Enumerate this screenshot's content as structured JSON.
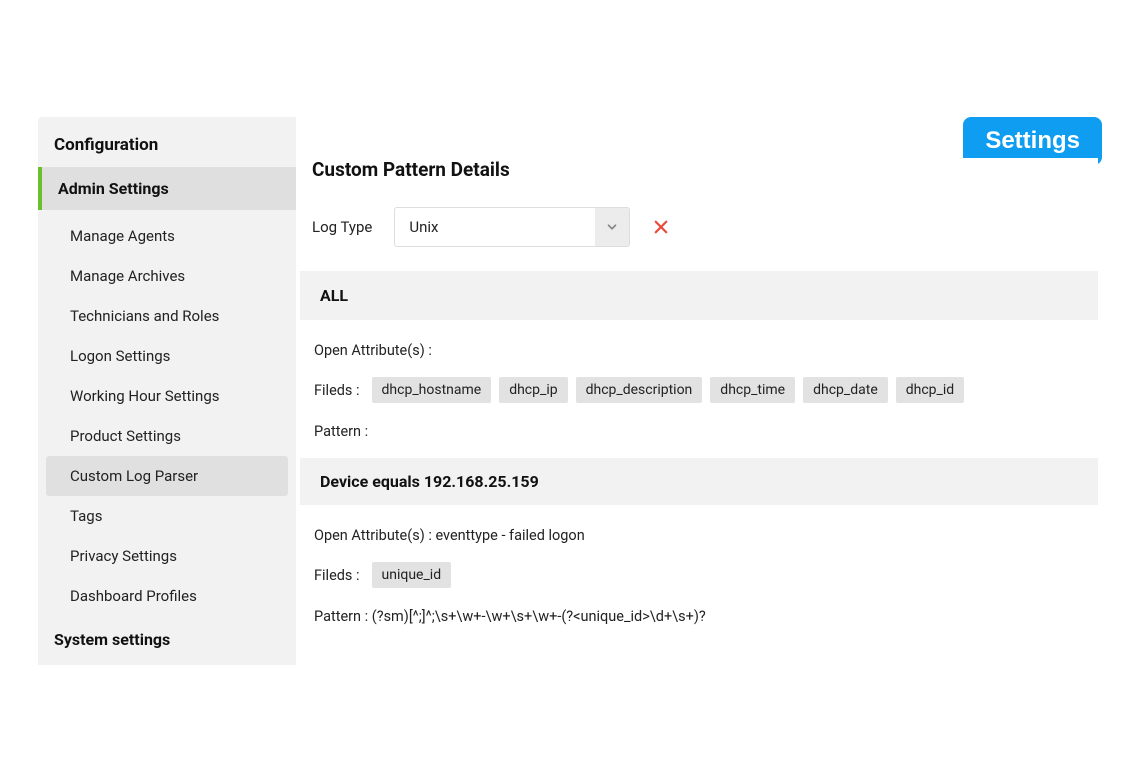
{
  "settingsButton": "Settings",
  "sidebar": {
    "header": "Configuration",
    "sectionTitle": "Admin Settings",
    "items": [
      "Manage Agents",
      "Manage Archives",
      "Technicians and Roles",
      "Logon Settings",
      "Working Hour Settings",
      "Product Settings",
      "Custom Log Parser",
      "Tags",
      "Privacy Settings",
      "Dashboard Profiles"
    ],
    "footerTitle": "System settings"
  },
  "main": {
    "title": "Custom Pattern Details",
    "logTypeLabel": "Log Type",
    "logTypeValue": "Unix",
    "section1": {
      "title": "ALL",
      "openAttrs": "Open Attribute(s) :",
      "fieldsLabel": "Fileds :",
      "fields": [
        "dhcp_hostname",
        "dhcp_ip",
        "dhcp_description",
        "dhcp_time",
        "dhcp_date",
        "dhcp_id"
      ],
      "patternLabel": "Pattern :"
    },
    "section2": {
      "title": "Device equals 192.168.25.159",
      "openAttrs": "Open Attribute(s) : eventtype - failed logon",
      "fieldsLabel": "Fileds :",
      "fields": [
        "unique_id"
      ],
      "pattern": "Pattern : (?sm)[^;]^;\\s+\\w+-\\w+\\s+\\w+-(?<unique_id>\\d+\\s+)?"
    }
  }
}
